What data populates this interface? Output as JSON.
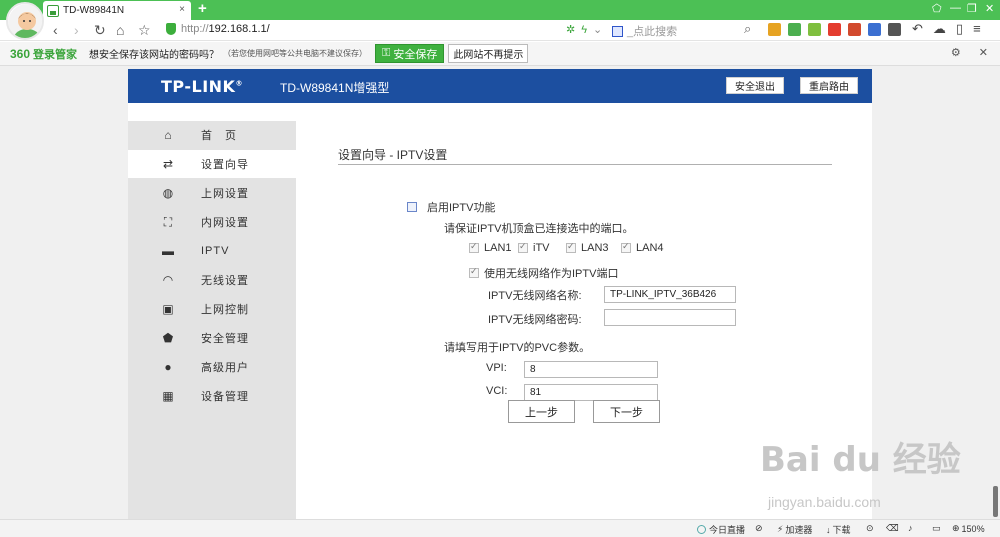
{
  "browser": {
    "tab_title": "TD-W89841N",
    "tab_close": "×",
    "new_tab": "+",
    "window_controls": [
      "⬠",
      "—",
      "❐",
      "✕"
    ],
    "nav": {
      "back": "‹",
      "forward": "›",
      "reload": "↻",
      "home": "⌂",
      "bookmark": "☆"
    },
    "url_protocol": "http://",
    "url_host": "192.168.1.1/",
    "search_placeholder": "_点此搜索",
    "search_icon": "search-icon",
    "toolbar_icon_colors": [
      "#e6a323",
      "#4caf50",
      "#7fbf3f",
      "#e43c2f",
      "#d24a2e",
      "#3b6fd1",
      "#555555"
    ],
    "right_icons": [
      "↶",
      "☁",
      "▯",
      "≡"
    ]
  },
  "infobar": {
    "brand": "360",
    "brand_sub": "登录管家",
    "question": "想安全保存该网站的密码吗？",
    "note": "（若您使用网吧等公共电脑不建议保存）",
    "save_button": "安全保存",
    "no_hint_button": "此网站不再提示",
    "settings_icon": "gear-icon",
    "close_icon": "close-icon"
  },
  "router": {
    "logo": "TP-LINK",
    "logo_mark": "®",
    "model": "TD-W89841N增强型",
    "logout_button": "安全退出",
    "reboot_button": "重启路由",
    "header_color": "#1c4fa0"
  },
  "sidebar": {
    "items": [
      {
        "label": "首　页",
        "icon": "home-icon",
        "glyph": "⌂",
        "active": false
      },
      {
        "label": "设置向导",
        "icon": "swap-arrows-icon",
        "glyph": "⇄",
        "active": true
      },
      {
        "label": "上网设置",
        "icon": "globe-icon",
        "glyph": "◍",
        "active": false
      },
      {
        "label": "内网设置",
        "icon": "network-icon",
        "glyph": "⛶",
        "active": false
      },
      {
        "label": "IPTV",
        "icon": "monitor-icon",
        "glyph": "▬",
        "active": false
      },
      {
        "label": "无线设置",
        "icon": "wifi-icon",
        "glyph": "◠",
        "active": false
      },
      {
        "label": "上网控制",
        "icon": "lock-icon",
        "glyph": "▣",
        "active": false
      },
      {
        "label": "安全管理",
        "icon": "shield-icon",
        "glyph": "⬟",
        "active": false
      },
      {
        "label": "高级用户",
        "icon": "user-icon",
        "glyph": "●",
        "active": false
      },
      {
        "label": "设备管理",
        "icon": "grid-icon",
        "glyph": "▦",
        "active": false
      }
    ]
  },
  "wizard": {
    "title": "设置向导 - IPTV设置",
    "enable_label": "启用IPTV功能",
    "enable_checked": false,
    "port_hint": "请保证IPTV机顶盒已连接选中的端口。",
    "ports": [
      {
        "label": "LAN1",
        "checked": true
      },
      {
        "label": "iTV",
        "checked": true
      },
      {
        "label": "LAN3",
        "checked": true
      },
      {
        "label": "LAN4",
        "checked": true
      }
    ],
    "wireless_label": "使用无线网络作为IPTV端口",
    "wireless_checked": true,
    "ssid_label": "IPTV无线网络名称:",
    "ssid_value": "TP-LINK_IPTV_36B426",
    "password_label": "IPTV无线网络密码:",
    "password_value": "",
    "pvc_hint": "请填写用于IPTV的PVC参数。",
    "vpi_label": "VPI:",
    "vpi_value": "8",
    "vci_label": "VCI:",
    "vci_value": "81",
    "prev_button": "上一步",
    "next_button": "下一步"
  },
  "watermark": {
    "main": "Bai du 经验",
    "sub": "jingyan.baidu.com"
  },
  "statusbar": {
    "live": "今日直播",
    "accelerator": "加速器",
    "download": "下载",
    "zoom": "150%"
  }
}
